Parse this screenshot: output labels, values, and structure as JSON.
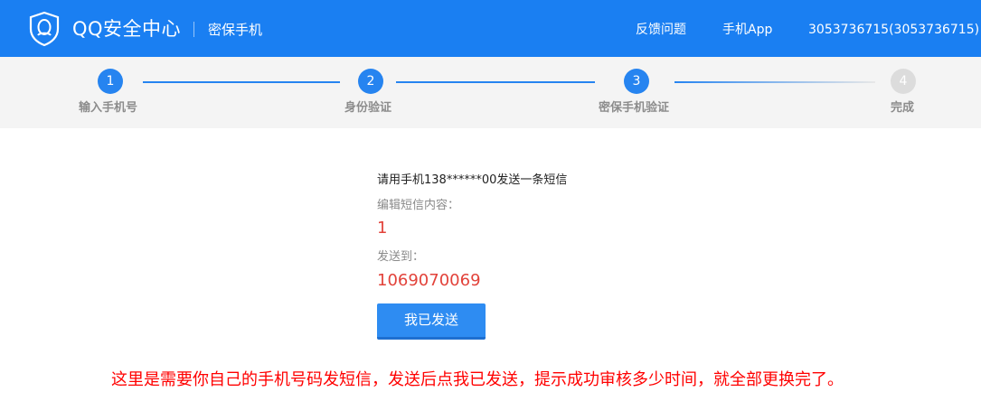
{
  "header": {
    "logo_icon": "qq-shield-icon",
    "brand": "QQ安全中心",
    "subtitle": "密保手机",
    "nav": {
      "feedback": "反馈问题",
      "app": "手机App",
      "account": "3053736715(3053736715)"
    }
  },
  "steps": [
    {
      "number": "1",
      "label": "输入手机号",
      "state": "done"
    },
    {
      "number": "2",
      "label": "身份验证",
      "state": "done"
    },
    {
      "number": "3",
      "label": "密保手机验证",
      "state": "current"
    },
    {
      "number": "4",
      "label": "完成",
      "state": "pending"
    }
  ],
  "main": {
    "instruction": "请用手机138******00发送一条短信",
    "sms_label": "编辑短信内容：",
    "sms_content": "1",
    "to_label": "发送到：",
    "to_number": "1069070069",
    "sent_button": "我已发送"
  },
  "annotation": "这里是需要你自己的手机号码发短信，发送后点我已发送，提示成功审核多少时间，就全部更换完了。",
  "colors": {
    "header_bg": "#1a7ff2",
    "step_active": "#2684f0",
    "step_inactive": "#dcdcdc",
    "value_red": "#e2423a",
    "annotation_red": "#ff0000"
  }
}
